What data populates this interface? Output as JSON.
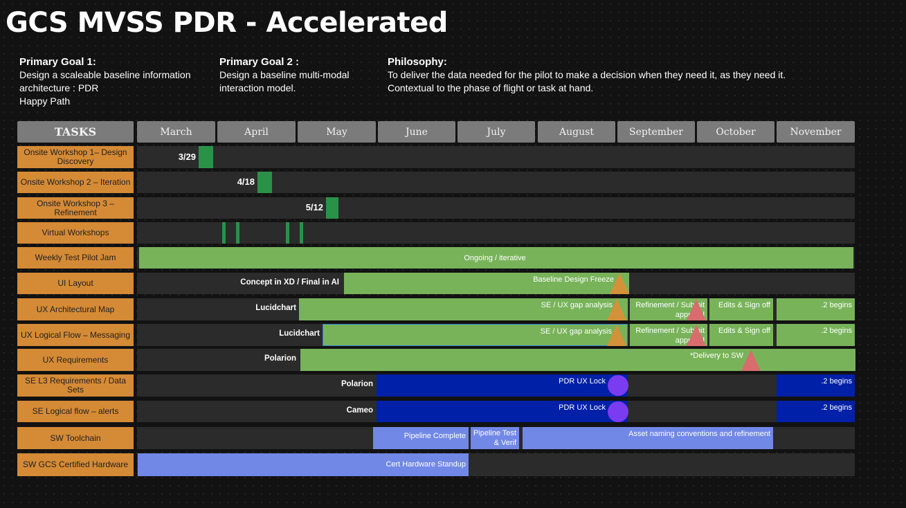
{
  "title": "GCS MVSS PDR - Accelerated",
  "goals": [
    {
      "heading": "Primary Goal 1:",
      "lines": [
        "Design a scaleable baseline information",
        "architecture :  PDR",
        "Happy Path"
      ]
    },
    {
      "heading": "Primary Goal 2 :",
      "lines": [
        "Design a baseline multi-modal",
        "interaction model."
      ]
    },
    {
      "heading": "Philosophy:",
      "lines": [
        "To deliver the data needed for the pilot to make a decision when they need it, as they need it.",
        "Contextual to the phase of flight or task at hand."
      ]
    }
  ],
  "tasks_header": "TASKS",
  "months": [
    "March",
    "April",
    "May",
    "June",
    "July",
    "August",
    "September",
    "October",
    "November"
  ],
  "tasks": [
    "Onsite Workshop 1– Design Discovery",
    "Onsite Workshop 2 – Iteration",
    "Onsite Workshop 3 – Refinement",
    "Virtual Workshops",
    "Weekly Test Pilot Jam",
    "UI Layout",
    "UX Architectural Map",
    "UX Logical Flow – Messaging",
    "UX Requirements",
    "SE L3 Requirements / Data Sets",
    "SE Logical flow – alerts",
    "SW  Toolchain",
    "SW GCS Certified Hardware"
  ],
  "bars": {
    "ws1": "3/29",
    "ws2": "4/18",
    "ws3": "5/12",
    "jam": "Ongoing / iterative",
    "ui_pre": "Concept in XD / Final in AI",
    "ui_main": "Baseline Design Freeze",
    "arch_pre": "Lucidchart",
    "gap": "SE / UX gap analysis",
    "refine": "Refinement / Submit approval",
    "edits": "Edits & Sign off",
    "begins": ".2  begins",
    "flow_pre": "Lucidchart",
    "req_pre": "Polarion",
    "req_main": "*Delivery to SW",
    "se_pre": "Polarion",
    "lock": "PDR UX Lock",
    "cameo": "Cameo",
    "pipe1": "Pipeline Complete",
    "pipe2": "Pipeline Test & Verif",
    "asset": "Asset naming conventions and refinement",
    "cert": "Cert Hardware Standup"
  },
  "colors": {
    "task": "#d58a35",
    "milestone": "#2a9148",
    "phase": "#78b35a",
    "se": "#0020a8",
    "sw": "#7188e6",
    "freeze": "#d3923a",
    "approval": "#d96d6d",
    "lock": "#7a3cf0"
  }
}
